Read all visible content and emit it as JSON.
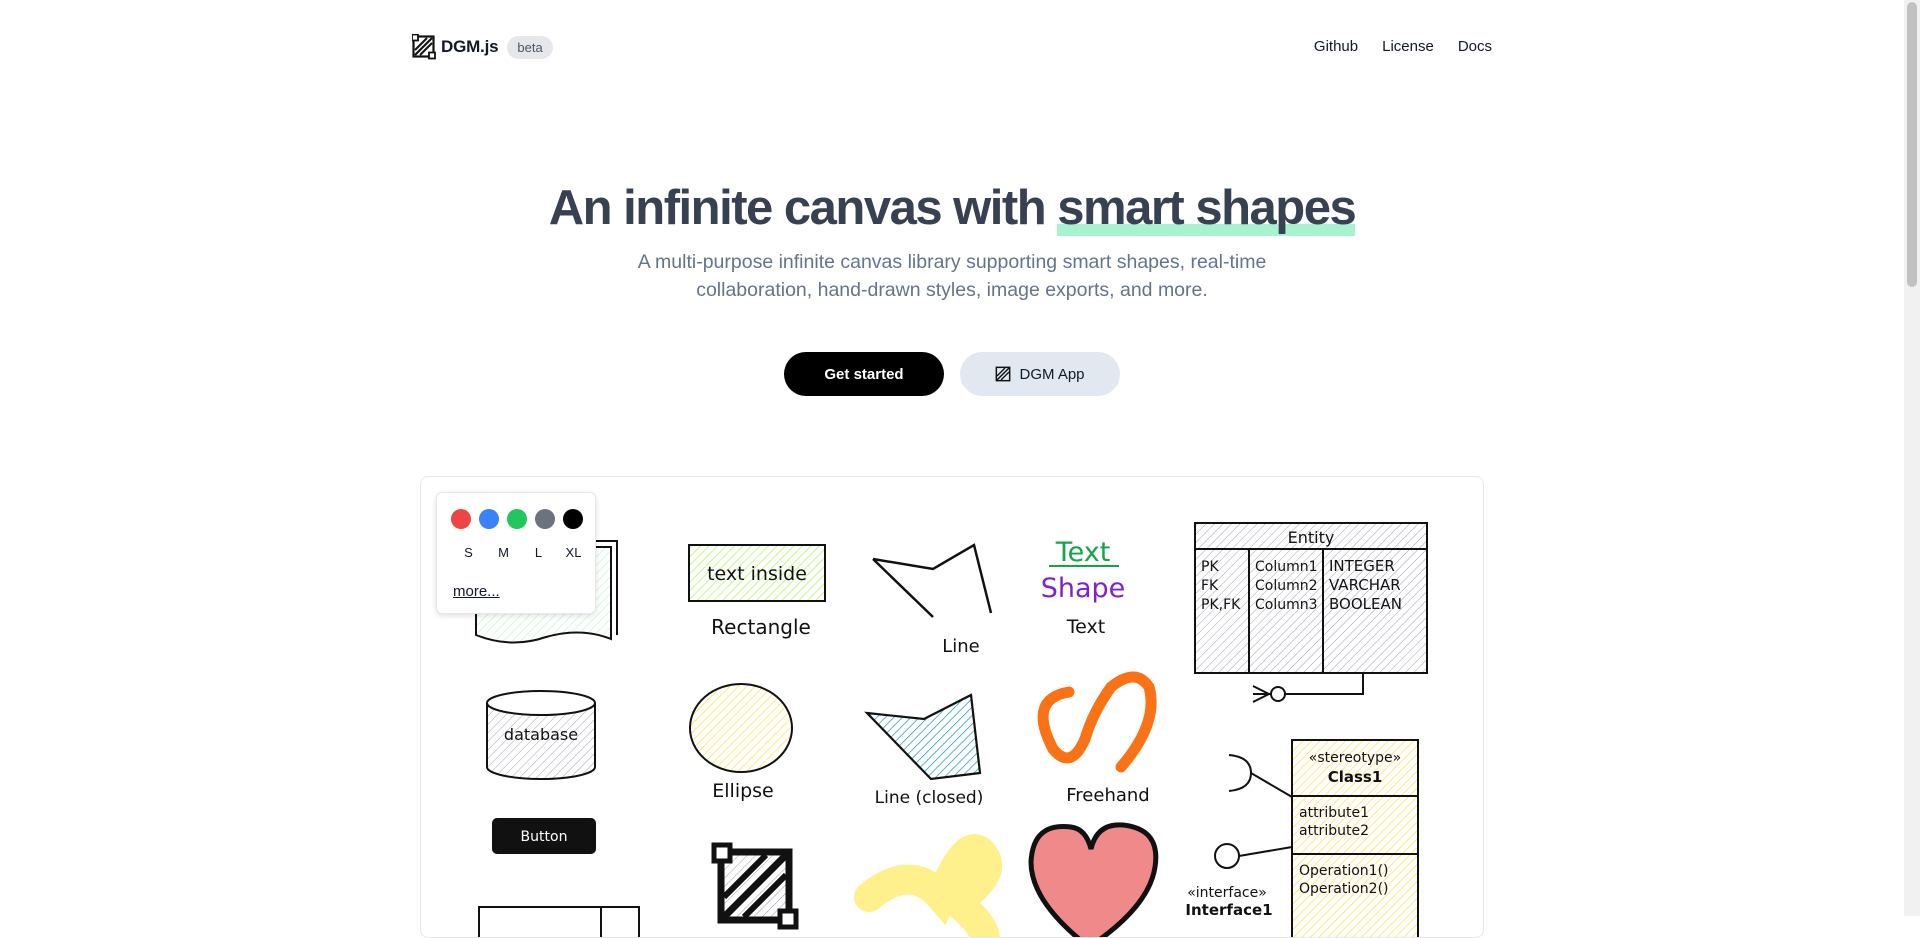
{
  "brand": {
    "name": "DGM.js",
    "badge": "beta"
  },
  "nav": {
    "links": [
      "Github",
      "License",
      "Docs"
    ]
  },
  "hero": {
    "title_part1": "An infinite canvas with ",
    "title_highlight": "smart shapes",
    "subtitle": "A multi-purpose infinite canvas library supporting smart shapes, real-time collaboration, hand-drawn styles, image exports, and more."
  },
  "cta": {
    "primary": "Get started",
    "secondary": "DGM App"
  },
  "palette": {
    "colors": [
      "#ef4444",
      "#3b82f6",
      "#22c55e",
      "#6b7280",
      "#000000"
    ],
    "sizes": [
      "S",
      "M",
      "L",
      "XL"
    ],
    "more": "more..."
  },
  "shapes": {
    "rect_text": "text inside",
    "rect_label": "Rectangle",
    "line_label": "Line",
    "text_green": "Text",
    "text_purple": "Shape",
    "text_label": "Text",
    "database": "database",
    "ellipse_label": "Ellipse",
    "line_closed_label": "Line (closed)",
    "freehand_label": "Freehand",
    "button": "Button",
    "entity": {
      "title": "Entity",
      "keys": [
        "PK",
        "FK",
        "PK,FK"
      ],
      "columns": [
        "Column1",
        "Column2",
        "Column3"
      ],
      "types": [
        "INTEGER",
        "VARCHAR",
        "BOOLEAN"
      ]
    },
    "class": {
      "stereotype": "«stereotype»",
      "name": "Class1",
      "attributes": [
        "attribute1",
        "attribute2"
      ],
      "operations": [
        "Operation1()",
        "Operation2()"
      ]
    },
    "interface": {
      "stereotype": "«interface»",
      "name": "Interface1"
    }
  }
}
